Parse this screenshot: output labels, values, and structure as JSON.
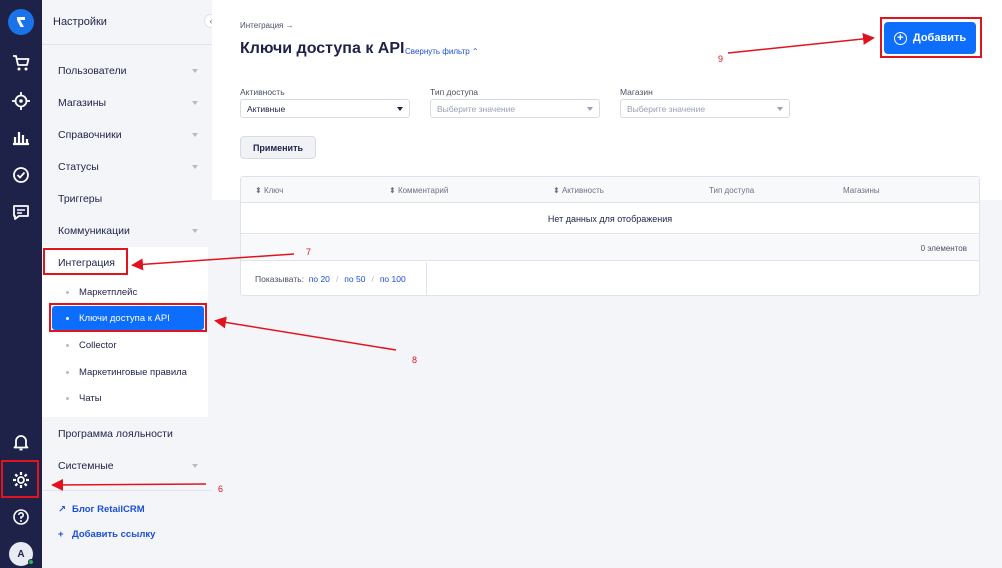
{
  "sidebar": {
    "icons": [
      "logo-icon",
      "cart-icon",
      "target-icon",
      "analytics-icon",
      "tasks-icon",
      "chat-icon",
      "bell-icon",
      "gear-icon",
      "help-icon"
    ],
    "avatar_initial": "A"
  },
  "settings_menu": {
    "title": "Настройки",
    "items": [
      {
        "label": "Пользователи"
      },
      {
        "label": "Магазины"
      },
      {
        "label": "Справочники"
      },
      {
        "label": "Статусы"
      },
      {
        "label": "Триггеры"
      },
      {
        "label": "Коммуникации"
      },
      {
        "label": "Интеграция"
      }
    ],
    "integration_sub": [
      {
        "label": "Маркетплейс"
      },
      {
        "label": "Ключи доступа к API"
      },
      {
        "label": "Collector"
      },
      {
        "label": "Маркетинговые правила"
      },
      {
        "label": "Чаты"
      }
    ],
    "bottom_items": [
      {
        "label": "Программа лояльности"
      },
      {
        "label": "Системные"
      }
    ],
    "links": {
      "blog": "Блог RetailCRM",
      "add_link": "Добавить ссылку"
    }
  },
  "main": {
    "breadcrumb": "Интеграция →",
    "title": "Ключи доступа к API",
    "toggle_filter": "Свернуть фильтр",
    "add_button": "Добавить",
    "filters": {
      "activity": {
        "label": "Активность",
        "value": "Активные"
      },
      "access_type": {
        "label": "Тип доступа",
        "placeholder": "Выберите значение"
      },
      "shop": {
        "label": "Магазин",
        "placeholder": "Выберите значение"
      }
    },
    "apply_button": "Применить",
    "table": {
      "columns": [
        "Ключ",
        "Комментарий",
        "Активность",
        "Тип доступа",
        "Магазины"
      ],
      "empty_text": "Нет данных для отображения",
      "count_text": "0 элементов",
      "pager_label": "Показывать:",
      "page_sizes": [
        "по 20",
        "по 50",
        "по 100"
      ]
    }
  },
  "annotations": [
    "6",
    "7",
    "8",
    "9"
  ],
  "colors": {
    "rail": "#1e2248",
    "accent": "#0d6efd",
    "annotation": "#e0141e"
  }
}
